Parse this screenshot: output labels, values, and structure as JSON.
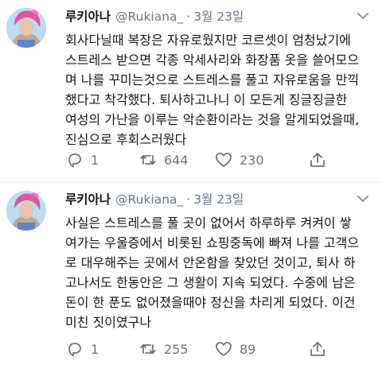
{
  "tweets": [
    {
      "display_name": "루키아나",
      "handle": "@Rukiana_",
      "separator": "·",
      "time": "3월 23일",
      "lines": [
        "회사다닐때 복장은 자유로웠지만 코르셋이 엄청났기에",
        "스트레스 받으면 각종 악세사리와 화장품 옷을 쓸어모으",
        "며 나를 꾸미는것으로 스트레스를 풀고 자유로움을 만끽",
        "했다고 착각했다. 퇴사하고나니 이 모든게 징글징글한",
        "여성의 가난을 이루는 악순환이라는 것을 알게되었을때,",
        "진심으로 후회스러웠다"
      ],
      "replies": "1",
      "retweets": "644",
      "likes": "230"
    },
    {
      "display_name": "루키아나",
      "handle": "@Rukiana_",
      "separator": "·",
      "time": "3월 23일",
      "lines": [
        "사실은 스트레스를 풀 곳이 없어서 하루하루 켜켜이 쌓",
        "여가는 우울증에서 비롯된 쇼핑중독에 빠져 나를 고객으",
        "로 대우해주는 곳에서 안온함을 찾았던 것이고, 퇴사 하",
        "고나서도 한동안은 그 생활이 지속 되었다. 수중에 남은",
        "돈이 한 푼도 없어졌을때야 정신을 차리게 되었다. 이건",
        "미친 짓이였구나"
      ],
      "replies": "1",
      "retweets": "255",
      "likes": "89"
    }
  ],
  "colors": {
    "text": "#14171a",
    "secondary": "#657786",
    "divider": "#e6ecf0",
    "avatar_bg": "#b9ddf2",
    "avatar_hair": "#e0559b"
  },
  "icons": [
    "avatar-image",
    "chevron-down-icon",
    "reply-icon",
    "retweet-icon",
    "like-icon",
    "share-icon"
  ]
}
